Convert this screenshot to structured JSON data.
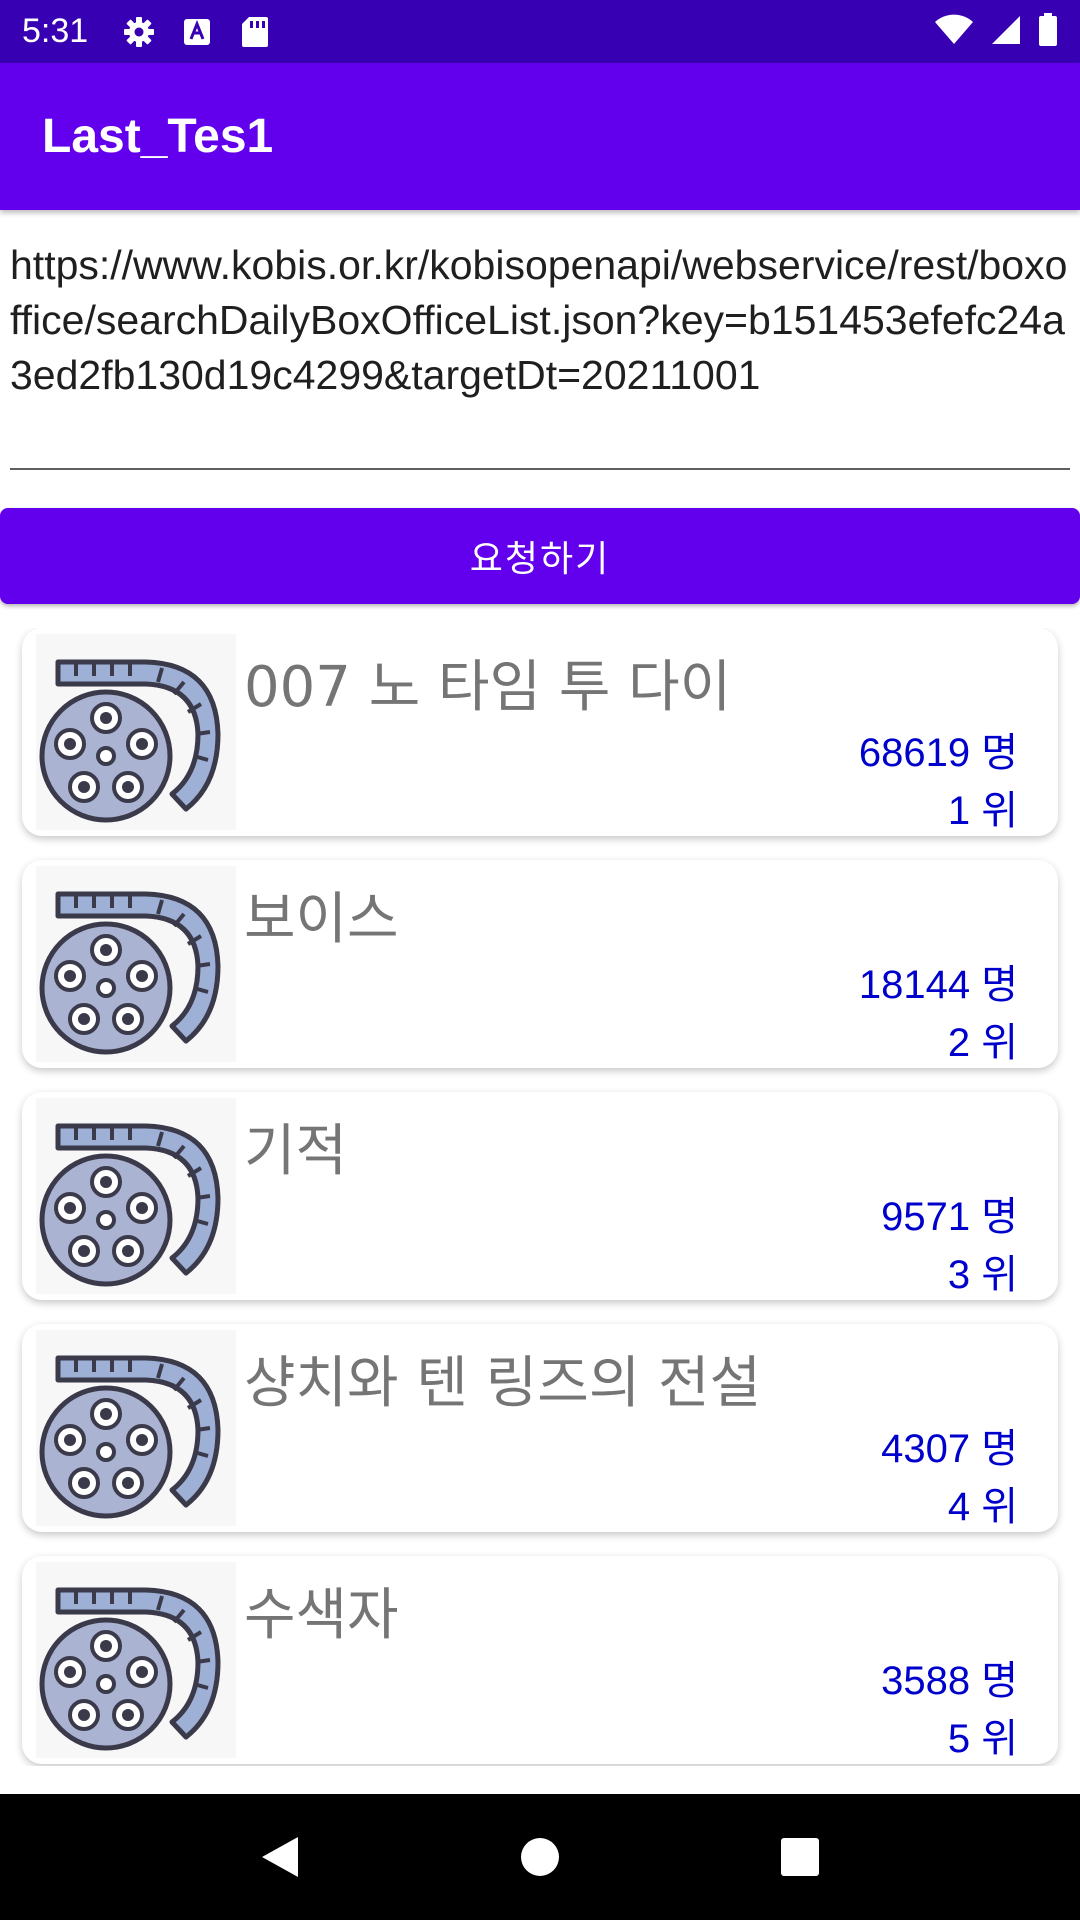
{
  "status_bar": {
    "time": "5:31",
    "left_icons": [
      "gear-icon",
      "a-text-icon",
      "sd-card-icon"
    ],
    "right_icons": [
      "wifi-icon",
      "signal-icon",
      "battery-icon"
    ]
  },
  "app_bar": {
    "title": "Last_Tes1"
  },
  "url_field": {
    "value": "https://www.kobis.or.kr/kobisopenapi/webservice/rest/boxoffice/searchDailyBoxOfficeList.json?key=b151453efefc24a3ed2fb130d19c4299&targetDt=20211001"
  },
  "request_button": {
    "label": "요청하기"
  },
  "movies": [
    {
      "title": "007 노 타임 투 다이",
      "audience": "68619 명",
      "rank": "1 위",
      "icon": "film-reel-icon"
    },
    {
      "title": "보이스",
      "audience": "18144 명",
      "rank": "2 위",
      "icon": "film-reel-icon"
    },
    {
      "title": "기적",
      "audience": "9571 명",
      "rank": "3 위",
      "icon": "film-reel-icon"
    },
    {
      "title": "샹치와 텐 링즈의 전설",
      "audience": "4307 명",
      "rank": "4 위",
      "icon": "film-reel-icon"
    },
    {
      "title": "수색자",
      "audience": "3588 명",
      "rank": "5 위",
      "icon": "film-reel-icon"
    }
  ],
  "nav_bar": {
    "buttons": [
      "back-icon",
      "home-icon",
      "recents-icon"
    ]
  },
  "colors": {
    "primary": "#6200ee",
    "primary_dark": "#3700b3",
    "count_text": "#0000cc",
    "title_text": "#757575"
  }
}
